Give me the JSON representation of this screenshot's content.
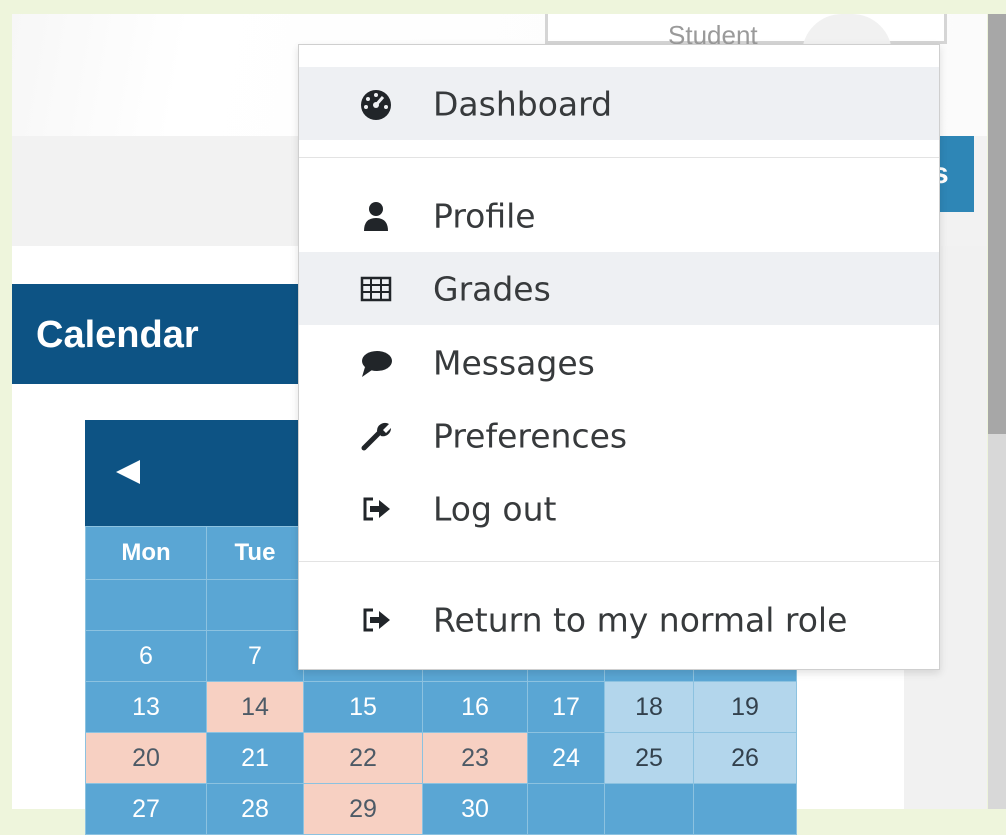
{
  "role_label": "Student",
  "nav_partial_text": "s",
  "calendar": {
    "title": "Calendar",
    "prev_icon": "left-triangle-icon",
    "weekdays": [
      "Mon",
      "Tue",
      "",
      "",
      "",
      "",
      ""
    ],
    "weeks": [
      [
        {
          "t": "",
          "s": "blue"
        },
        {
          "t": "",
          "s": "blue"
        },
        {
          "t": "",
          "s": "blue"
        },
        {
          "t": "",
          "s": "blue"
        },
        {
          "t": "",
          "s": "blue"
        },
        {
          "t": "",
          "s": "blue"
        },
        {
          "t": "",
          "s": "blue"
        }
      ],
      [
        {
          "t": "6",
          "s": "blue"
        },
        {
          "t": "7",
          "s": "blue"
        },
        {
          "t": "",
          "s": "blue"
        },
        {
          "t": "",
          "s": "blue"
        },
        {
          "t": "",
          "s": "blue"
        },
        {
          "t": "",
          "s": "blue"
        },
        {
          "t": "",
          "s": "blue"
        }
      ],
      [
        {
          "t": "13",
          "s": "blue"
        },
        {
          "t": "14",
          "s": "salmon"
        },
        {
          "t": "15",
          "s": "blue"
        },
        {
          "t": "16",
          "s": "blue"
        },
        {
          "t": "17",
          "s": "blue"
        },
        {
          "t": "18",
          "s": "light"
        },
        {
          "t": "19",
          "s": "light"
        }
      ],
      [
        {
          "t": "20",
          "s": "salmon"
        },
        {
          "t": "21",
          "s": "blue"
        },
        {
          "t": "22",
          "s": "salmon"
        },
        {
          "t": "23",
          "s": "salmon"
        },
        {
          "t": "24",
          "s": "blue"
        },
        {
          "t": "25",
          "s": "light"
        },
        {
          "t": "26",
          "s": "light"
        }
      ],
      [
        {
          "t": "27",
          "s": "blue"
        },
        {
          "t": "28",
          "s": "blue"
        },
        {
          "t": "29",
          "s": "salmon"
        },
        {
          "t": "30",
          "s": "blue"
        },
        {
          "t": "",
          "s": "blue"
        },
        {
          "t": "",
          "s": "blue"
        },
        {
          "t": "",
          "s": "blue"
        }
      ]
    ]
  },
  "menu": {
    "dashboard": {
      "label": "Dashboard",
      "icon": "dashboard-gauge-icon"
    },
    "profile": {
      "label": "Profile",
      "icon": "user-icon"
    },
    "grades": {
      "label": "Grades",
      "icon": "table-icon"
    },
    "messages": {
      "label": "Messages",
      "icon": "speech-bubble-icon"
    },
    "preferences": {
      "label": "Preferences",
      "icon": "wrench-icon"
    },
    "logout": {
      "label": "Log out",
      "icon": "sign-out-icon"
    },
    "return_role": {
      "label": "Return to my normal role",
      "icon": "sign-out-icon"
    }
  },
  "colors": {
    "calendar_blue": "#5aa6d4",
    "header_navy": "#0d5384",
    "event_salmon": "#f7d0c2",
    "weekend_light": "#b3d6ec",
    "menu_highlight": "#eef0f3"
  }
}
